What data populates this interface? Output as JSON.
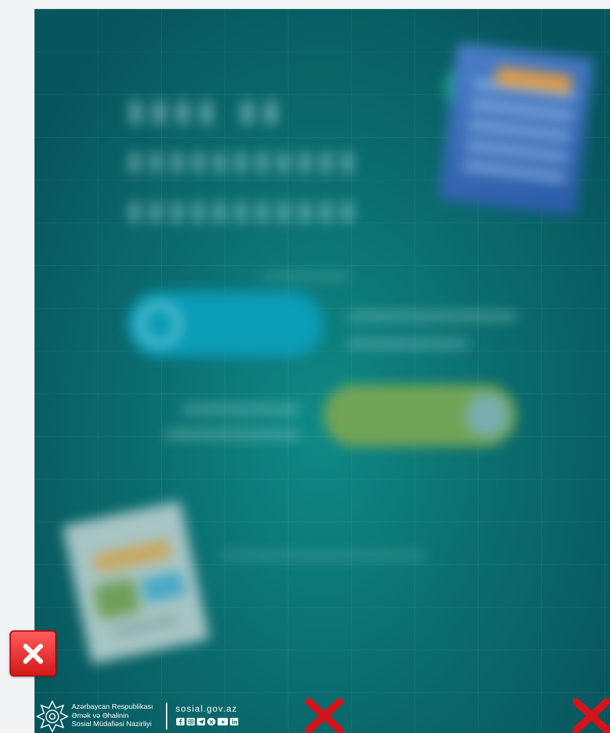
{
  "footer": {
    "ministry_lines": [
      "Azərbaycan Respublikası",
      "Əmək və Əhalinin",
      "Sosial Müdafiəsi Nazirliyi"
    ],
    "website": "sosial.gov.az",
    "social_icons": [
      "facebook-icon",
      "instagram-icon",
      "telegram-icon",
      "x-twitter-icon",
      "youtube-icon",
      "linkedin-icon"
    ]
  },
  "colors": {
    "poster_teal": "#0b6f71",
    "close_red": "#e02424",
    "mark_red": "#d3141c",
    "page_bg": "#f1f3f5"
  },
  "icons": {
    "close_button": "close-icon",
    "red_marks": [
      "red-x-mark-icon",
      "red-x-mark-icon"
    ],
    "logo": "ministry-emblem-icon"
  }
}
